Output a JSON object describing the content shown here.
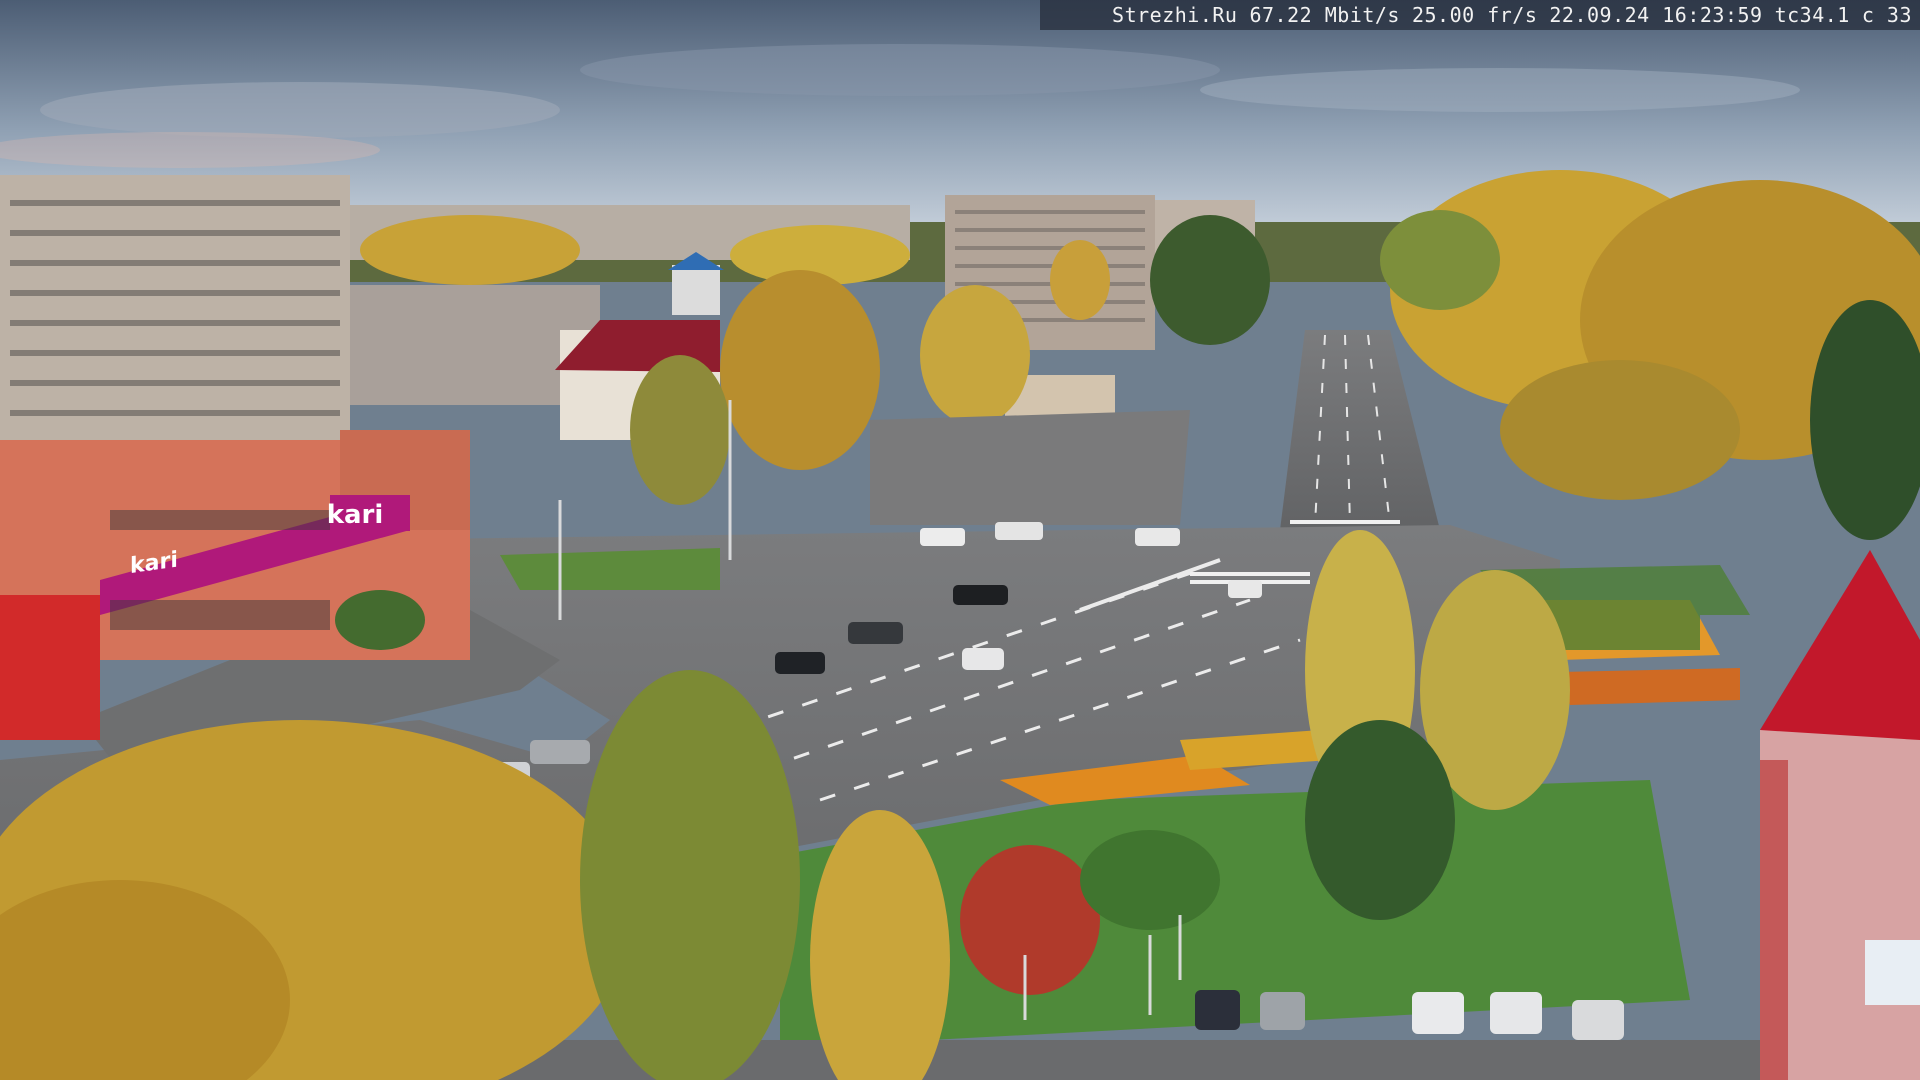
{
  "overlay": {
    "site": "Strezhi.Ru",
    "bitrate": "67.22 Mbit/s",
    "framerate": "25.00 fr/s",
    "datetime": "22.09.24 16:23:59",
    "camera": "tc34.1",
    "channel": "c 33"
  },
  "scene": {
    "store_logo": "kari",
    "store_logo_small": "kari"
  },
  "colors": {
    "sky_top": "#4d5f76",
    "sky_bottom": "#b9c5d2",
    "asphalt": "#6b6c6e",
    "grass": "#4f8a3a",
    "autumn_yellow": "#c9a43a",
    "store_magenta": "#b0197a",
    "roof_red": "#c2182b"
  }
}
